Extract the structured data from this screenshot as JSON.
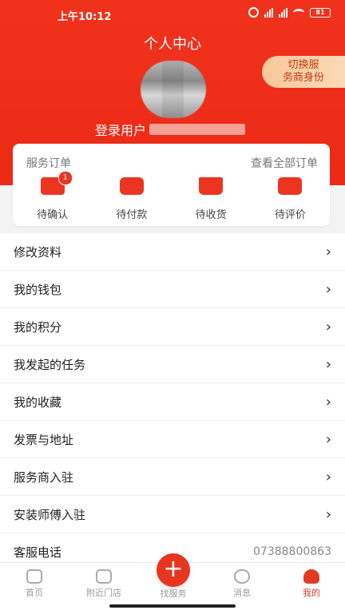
{
  "status_bar": {
    "time": "上午10:12",
    "battery": "81"
  },
  "header": {
    "title": "个人中心",
    "switch_role_line1": "切换服",
    "switch_role_line2": "务商身份",
    "login_prefix": "登录用户"
  },
  "orders": {
    "title": "服务订单",
    "view_all": "查看全部订单",
    "items": [
      {
        "label": "待确认",
        "badge": "1",
        "icon": "box-clock-icon"
      },
      {
        "label": "待付款",
        "icon": "wallet-icon"
      },
      {
        "label": "待收货",
        "icon": "tray-download-icon"
      },
      {
        "label": "待评价",
        "icon": "chat-bubble-icon"
      }
    ]
  },
  "menu": {
    "items": [
      {
        "label": "修改资料"
      },
      {
        "label": "我的钱包"
      },
      {
        "label": "我的积分"
      },
      {
        "label": "我发起的任务"
      },
      {
        "label": "我的收藏"
      },
      {
        "label": "发票与地址"
      },
      {
        "label": "服务商入驻"
      },
      {
        "label": "安装师傅入驻"
      },
      {
        "label": "客服电话",
        "value": "07388800863"
      }
    ]
  },
  "tabbar": {
    "items": [
      {
        "label": "首页",
        "icon": "home-icon"
      },
      {
        "label": "附近门店",
        "icon": "store-icon"
      },
      {
        "label": "找服务",
        "icon": "plus-icon"
      },
      {
        "label": "消息",
        "icon": "message-icon"
      },
      {
        "label": "我的",
        "icon": "user-icon",
        "active": true
      }
    ]
  },
  "colors": {
    "accent": "#ec3521",
    "switch_bg": "#f9c79a"
  }
}
